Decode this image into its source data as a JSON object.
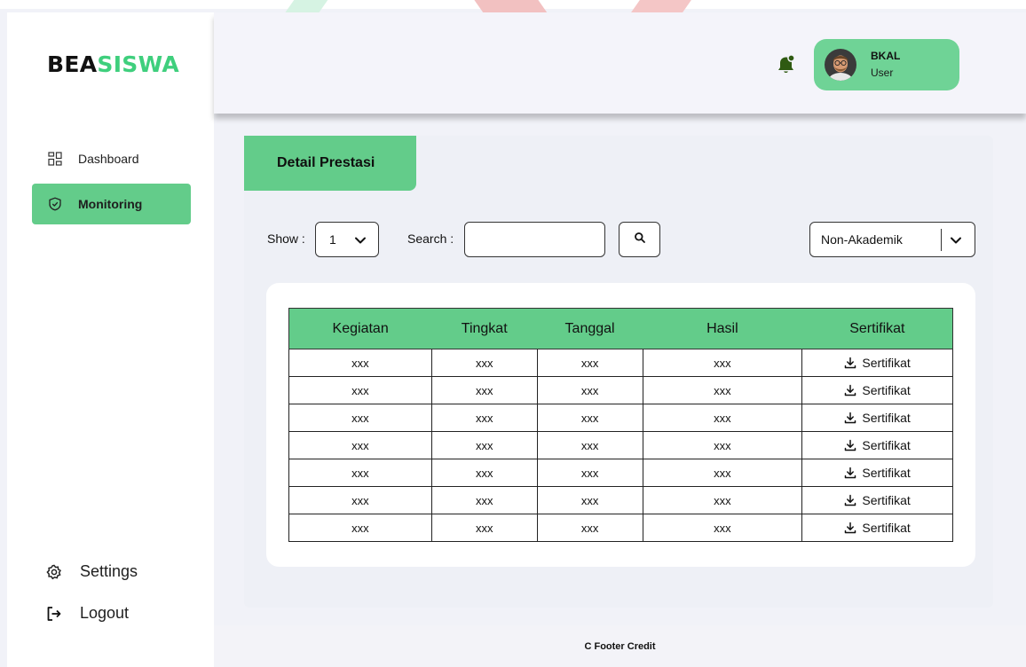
{
  "brand": {
    "logo_part1": "BEA",
    "logo_part2": "SISWA"
  },
  "sidebar": {
    "items": [
      {
        "label": "Dashboard",
        "icon": "dashboard-grid-icon"
      },
      {
        "label": "Monitoring",
        "icon": "shield-check-icon",
        "active": true
      }
    ],
    "settings_label": "Settings",
    "logout_label": "Logout"
  },
  "header": {
    "notification_icon": "bell-icon",
    "user": {
      "name": "BKAL",
      "role": "User"
    }
  },
  "panel": {
    "title": "Detail Prestasi",
    "show_label": "Show :",
    "show_value": "1",
    "search_label": "Search :",
    "search_value": "",
    "search_placeholder": "",
    "category_value": "Non-Akademik"
  },
  "table": {
    "columns": [
      "Kegiatan",
      "Tingkat",
      "Tanggal",
      "Hasil",
      "Sertifikat"
    ],
    "rows": [
      [
        "xxx",
        "xxx",
        "xxx",
        "xxx",
        "Sertifikat"
      ],
      [
        "xxx",
        "xxx",
        "xxx",
        "xxx",
        "Sertifikat"
      ],
      [
        "xxx",
        "xxx",
        "xxx",
        "xxx",
        "Sertifikat"
      ],
      [
        "xxx",
        "xxx",
        "xxx",
        "xxx",
        "Sertifikat"
      ],
      [
        "xxx",
        "xxx",
        "xxx",
        "xxx",
        "Sertifikat"
      ],
      [
        "xxx",
        "xxx",
        "xxx",
        "xxx",
        "Sertifikat"
      ],
      [
        "xxx",
        "xxx",
        "xxx",
        "xxx",
        "Sertifikat"
      ]
    ]
  },
  "footer": {
    "text": "C Footer Credit"
  },
  "colors": {
    "accent": "#63cc8a",
    "brand_green": "#3fcf7d",
    "bell": "#2f5a12",
    "background": "#f1f2f8"
  }
}
